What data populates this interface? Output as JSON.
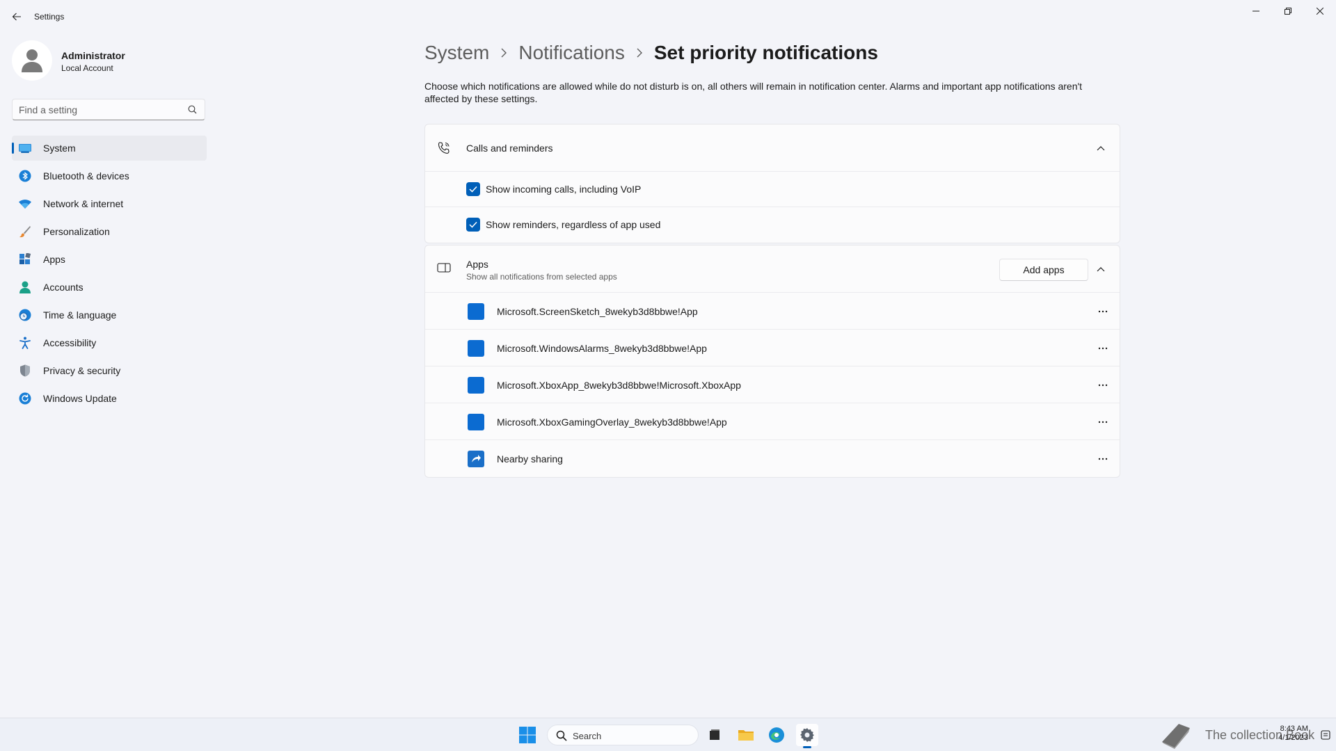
{
  "window": {
    "title": "Settings"
  },
  "profile": {
    "name": "Administrator",
    "account_type": "Local Account"
  },
  "search": {
    "placeholder": "Find a setting"
  },
  "sidebar": {
    "items": [
      {
        "label": "System",
        "icon": "monitor-icon",
        "active": true
      },
      {
        "label": "Bluetooth & devices",
        "icon": "bluetooth-icon"
      },
      {
        "label": "Network & internet",
        "icon": "wifi-icon"
      },
      {
        "label": "Personalization",
        "icon": "brush-icon"
      },
      {
        "label": "Apps",
        "icon": "apps-icon"
      },
      {
        "label": "Accounts",
        "icon": "person-icon"
      },
      {
        "label": "Time & language",
        "icon": "globe-clock-icon"
      },
      {
        "label": "Accessibility",
        "icon": "accessibility-icon"
      },
      {
        "label": "Privacy & security",
        "icon": "shield-icon"
      },
      {
        "label": "Windows Update",
        "icon": "refresh-icon"
      }
    ]
  },
  "breadcrumb": {
    "level1": "System",
    "level2": "Notifications",
    "current": "Set priority notifications"
  },
  "description": "Choose which notifications are allowed while do not disturb is on, all others will remain in notification center. Alarms and important app notifications aren't affected by these settings.",
  "calls_card": {
    "title": "Calls and reminders",
    "options": [
      {
        "label": "Show incoming calls, including VoIP",
        "checked": true
      },
      {
        "label": "Show reminders, regardless of app used",
        "checked": true
      }
    ]
  },
  "apps_card": {
    "title": "Apps",
    "subtitle": "Show all notifications from selected apps",
    "add_button": "Add apps",
    "apps": [
      {
        "label": "Microsoft.ScreenSketch_8wekyb3d8bbwe!App"
      },
      {
        "label": "Microsoft.WindowsAlarms_8wekyb3d8bbwe!App"
      },
      {
        "label": "Microsoft.XboxApp_8wekyb3d8bbwe!Microsoft.XboxApp"
      },
      {
        "label": "Microsoft.XboxGamingOverlay_8wekyb3d8bbwe!App"
      },
      {
        "label": "Nearby sharing"
      }
    ]
  },
  "taskbar": {
    "search_label": "Search",
    "tray_text": "The collection Book",
    "time": "8:43 AM",
    "date": "4/1/2023"
  },
  "colors": {
    "accent": "#005fb8",
    "app_tile": "#0b6bd1",
    "background": "#f3f4f9"
  }
}
